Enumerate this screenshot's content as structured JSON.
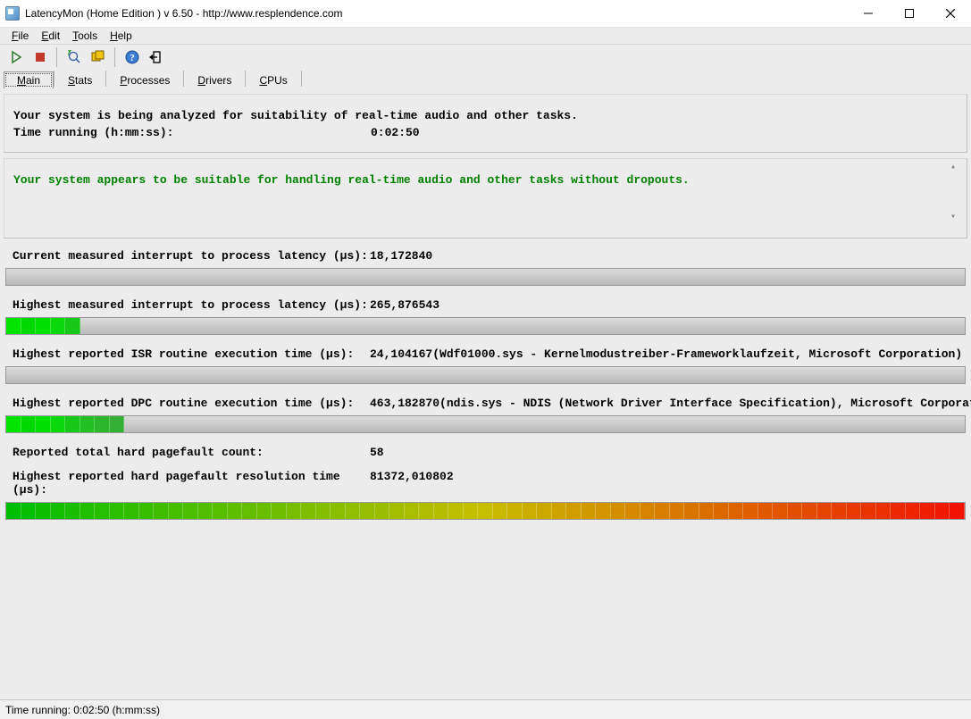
{
  "title": "LatencyMon  (Home Edition )  v 6.50 - http://www.resplendence.com",
  "menu": [
    {
      "u": "F",
      "r": "ile"
    },
    {
      "u": "E",
      "r": "dit"
    },
    {
      "u": "T",
      "r": "ools"
    },
    {
      "u": "H",
      "r": "elp"
    }
  ],
  "tabs": [
    {
      "u": "M",
      "r": "ain"
    },
    {
      "u": "S",
      "r": "tats"
    },
    {
      "u": "P",
      "r": "rocesses"
    },
    {
      "u": "D",
      "r": "rivers"
    },
    {
      "u": "C",
      "r": "PUs"
    }
  ],
  "main": {
    "analysis_line": "Your system is being analyzed for suitability of real-time audio and other tasks.",
    "time_running_label": "Time running (h:mm:ss):",
    "time_running_value": "0:02:50",
    "status_text": "Your system appears to be suitable for handling real-time audio and other tasks without dropouts."
  },
  "metrics": [
    {
      "bar": true,
      "lines": [
        {
          "label": "Current measured interrupt to process latency (µs):",
          "value": "18,172840",
          "extra": ""
        }
      ],
      "bar_segments": 0
    },
    {
      "bar": true,
      "lines": [
        {
          "label": "Highest measured interrupt to process latency (µs):",
          "value": "265,876543",
          "extra": ""
        }
      ],
      "bar_segments": 5
    },
    {
      "bar": true,
      "lines": [
        {
          "label": "Highest reported ISR routine execution time (µs):",
          "value": "24,104167",
          "extra": "  (Wdf01000.sys - Kernelmodustreiber-Frameworklaufzeit, Microsoft Corporation)"
        }
      ],
      "bar_segments": 0
    },
    {
      "bar": true,
      "lines": [
        {
          "label": "Highest reported DPC routine execution time (µs):",
          "value": "463,182870",
          "extra": "  (ndis.sys - NDIS (Network Driver Interface Specification), Microsoft Corporation)"
        }
      ],
      "bar_segments": 8
    },
    {
      "bar": true,
      "lines": [
        {
          "label": "Reported total hard pagefault count:",
          "value": "58",
          "extra": ""
        },
        {
          "label": "Highest reported hard pagefault resolution time (µs):",
          "value": "81372,010802",
          "extra": ""
        }
      ],
      "bar_segments": 65,
      "bar_full_spectrum": true
    }
  ],
  "statusbar": "Time running: 0:02:50  (h:mm:ss)"
}
